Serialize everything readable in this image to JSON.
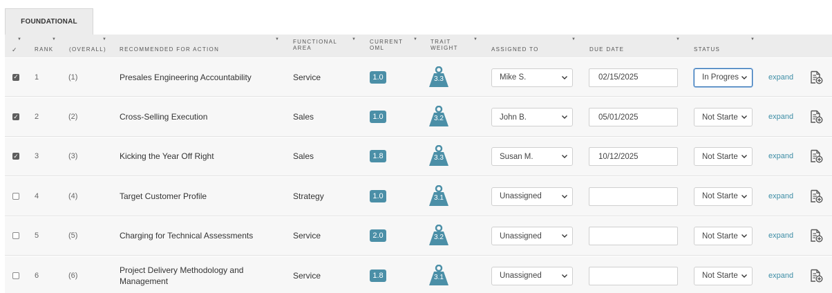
{
  "tab": {
    "label": "FOUNDATIONAL"
  },
  "columns": {
    "check": "✓",
    "rank": "RANK",
    "overall": "(OVERALL)",
    "action": "RECOMMENDED FOR ACTION",
    "area_line1": "FUNCTIONAL",
    "area_line2": "AREA",
    "oml_line1": "CURRENT",
    "oml_line2": "OML",
    "weight_line1": "TRAIT",
    "weight_line2": "WEIGHT",
    "assigned": "ASSIGNED TO",
    "due": "DUE DATE",
    "status": "STATUS"
  },
  "icons": {
    "check": "checkmark",
    "select": "chevron-down-icon",
    "weight": "weight-icon",
    "doc": "document-add-icon"
  },
  "colors": {
    "oml_badge": "#4b8fa7",
    "weight_icon": "#4b8fa7",
    "link": "#3e8ea6"
  },
  "rows": [
    {
      "checked": true,
      "rank": "1",
      "overall": "(1)",
      "action": "Presales Engineering Accountability",
      "area": "Service",
      "oml": "1.0",
      "weight": "3.3",
      "assigned": "Mike S.",
      "due": "02/15/2025",
      "status": "In Progres",
      "status_focused": true,
      "expand": "expand"
    },
    {
      "checked": true,
      "rank": "2",
      "overall": "(2)",
      "action": "Cross-Selling Execution",
      "area": "Sales",
      "oml": "1.0",
      "weight": "3.2",
      "assigned": "John B.",
      "due": "05/01/2025",
      "status": "Not Starte",
      "status_focused": false,
      "expand": "expand"
    },
    {
      "checked": true,
      "rank": "3",
      "overall": "(3)",
      "action": "Kicking the Year Off Right",
      "area": "Sales",
      "oml": "1.8",
      "weight": "3.3",
      "assigned": "Susan M.",
      "due": "10/12/2025",
      "status": "Not Starte",
      "status_focused": false,
      "expand": "expand"
    },
    {
      "checked": false,
      "rank": "4",
      "overall": "(4)",
      "action": "Target Customer Profile",
      "area": "Strategy",
      "oml": "1.0",
      "weight": "3.1",
      "assigned": "Unassigned",
      "due": "",
      "status": "Not Starte",
      "status_focused": false,
      "expand": "expand"
    },
    {
      "checked": false,
      "rank": "5",
      "overall": "(5)",
      "action": "Charging for Technical Assessments",
      "area": "Service",
      "oml": "2.0",
      "weight": "3.2",
      "assigned": "Unassigned",
      "due": "",
      "status": "Not Starte",
      "status_focused": false,
      "expand": "expand"
    },
    {
      "checked": false,
      "rank": "6",
      "overall": "(6)",
      "action": "Project Delivery Methodology and Management",
      "area": "Service",
      "oml": "1.8",
      "weight": "3.1",
      "assigned": "Unassigned",
      "due": "",
      "status": "Not Starte",
      "status_focused": false,
      "expand": "expand"
    }
  ]
}
